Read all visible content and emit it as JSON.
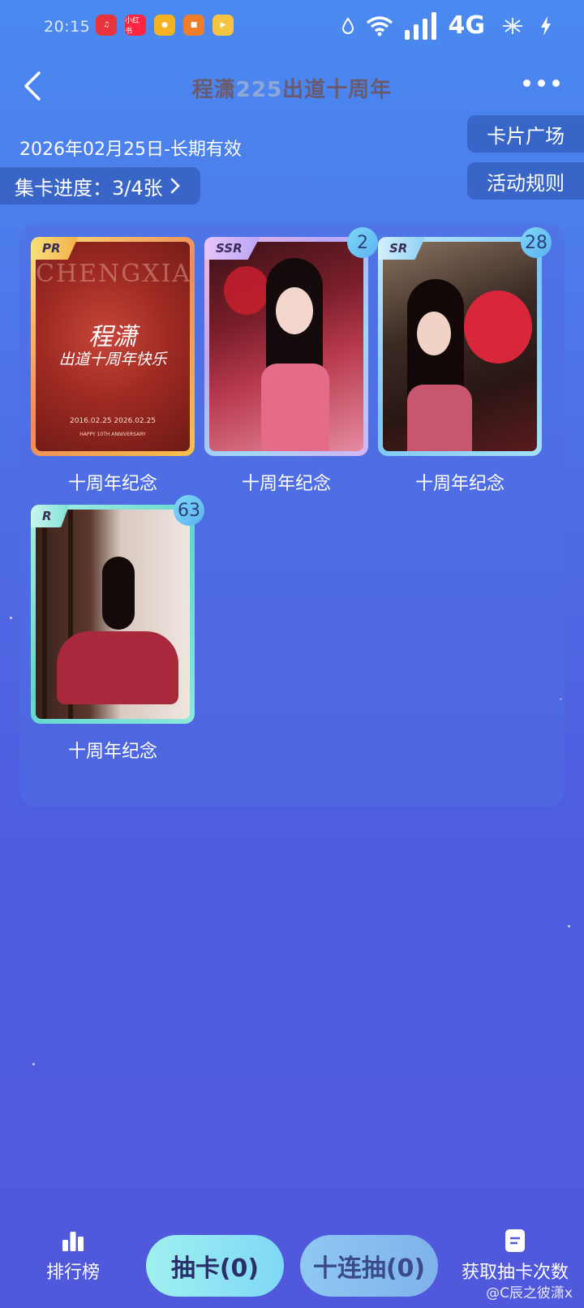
{
  "status_bar": {
    "time": "20:15",
    "app_icons": [
      {
        "name": "music-app-icon",
        "label": "",
        "color": "#e8323c"
      },
      {
        "name": "xiaohongshu-app-icon",
        "label": "小红书",
        "color": "#ff2442"
      },
      {
        "name": "weibo-app-icon",
        "label": "",
        "color": "#f5b321"
      },
      {
        "name": "photo-app-icon",
        "label": "",
        "color": "#f07d2a"
      },
      {
        "name": "video-app-icon",
        "label": "",
        "color": "#f6c343"
      }
    ],
    "network": "4G"
  },
  "header": {
    "title_prefix": "程潇",
    "title_number": "225",
    "title_suffix": "出道十周年"
  },
  "info": {
    "validity": "2026年02月25日-长期有效",
    "progress": "集卡进度：3/4张",
    "card_plaza": "卡片广场",
    "activity_rules": "活动规则"
  },
  "cards": [
    {
      "rarity": "PR",
      "name": "十周年纪念",
      "count": "",
      "frame": "#f4c24a",
      "art": "pr",
      "art_text_1": "程潇",
      "art_text_2": "出道十周年快乐",
      "art_bg": "CHENGXIAO",
      "art_dates": "2016.02.25   2026.02.25",
      "art_sub": "HAPPY 10TH ANNIVERSARY"
    },
    {
      "rarity": "SSR",
      "name": "十周年纪念",
      "count": "2",
      "frame": "#c8a6f4",
      "art": "ssr"
    },
    {
      "rarity": "SR",
      "name": "十周年纪念",
      "count": "28",
      "frame": "#8fd2f6",
      "art": "sr"
    },
    {
      "rarity": "R",
      "name": "十周年纪念",
      "count": "63",
      "frame": "#6fe0d6",
      "art": "r"
    }
  ],
  "bottom_nav": {
    "ranking": "排行榜",
    "draw": "抽卡(0)",
    "draw_ten": "十连抽(0)",
    "get_draws": "获取抽卡次数"
  },
  "watermark": "@C辰之彼潇x"
}
